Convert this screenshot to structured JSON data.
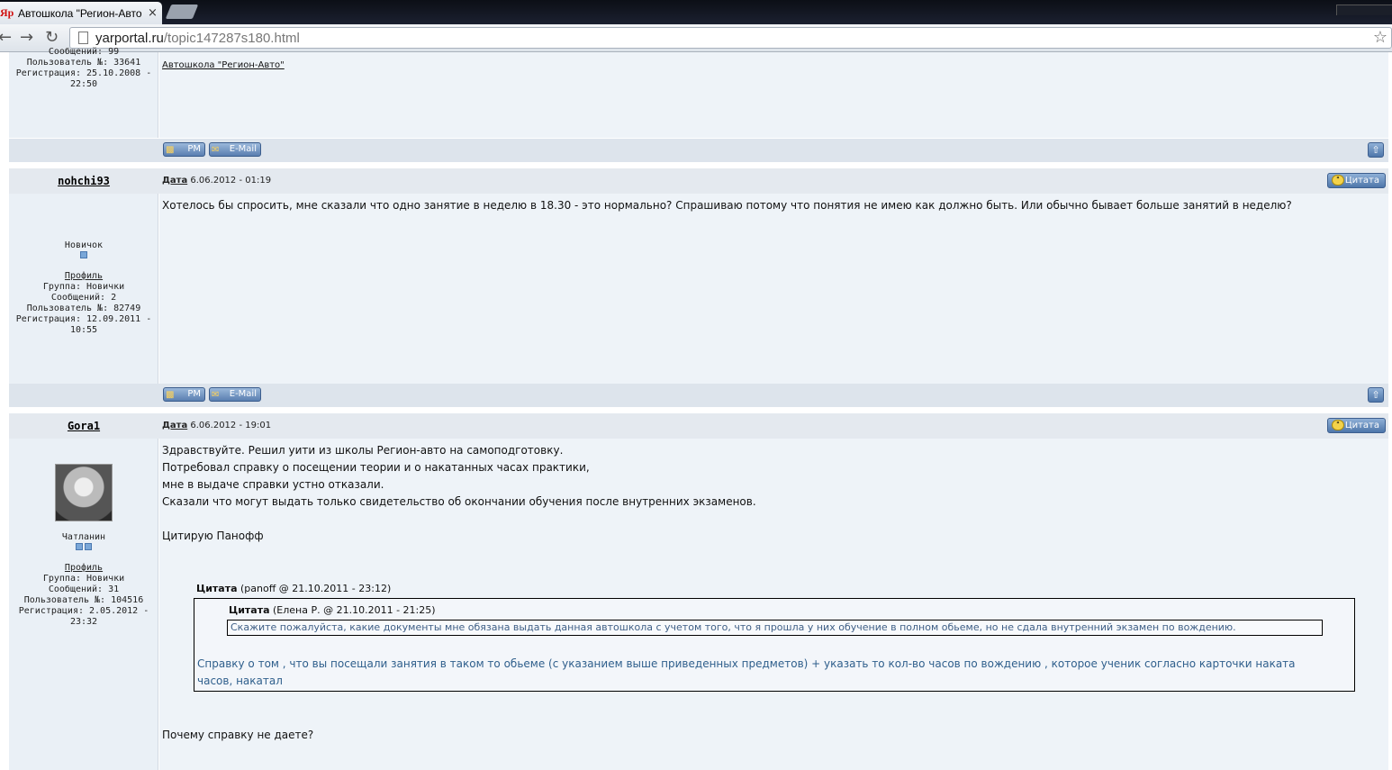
{
  "browser": {
    "tab_favicon": "Яр",
    "tab_title": "Автошкола \"Регион-Авто\"",
    "tab_close": "×",
    "url_host": "yarportal.ru",
    "url_path": "/topic147287s180.html",
    "icons": [
      "back-arrow-icon",
      "forward-arrow-icon",
      "reload-icon",
      "page-icon",
      "bookmark-star-icon"
    ]
  },
  "prev_post": {
    "meta_cut": "Сообщений: 99",
    "meta_user_no": "Пользователь №: 33641",
    "meta_reg": "Регистрация: 25.10.2008 -",
    "meta_reg_time": "22:50",
    "signature_link": "Автошкола \"Регион-Авто\""
  },
  "buttons": {
    "pm": "PM",
    "email": "E-Mail",
    "quote": "Цитата",
    "date_label": "Дата"
  },
  "posts": [
    {
      "author": "nohchi93",
      "date": "6.06.2012 - 01:19",
      "text": "Хотелось бы спросить, мне сказали что одно занятие в неделю в 18.30 - это нормально? Спрашиваю потому что понятия не имею как должно быть. Или обычно бывает больше занятий в неделю?",
      "rank": "Новичок",
      "profile": "Профиль",
      "group": "Группа: Новички",
      "messages": "Сообщений: 2",
      "user_no": "Пользователь №: 82749",
      "reg": "Регистрация: 12.09.2011 -",
      "reg_time": "10:55"
    },
    {
      "author": "Gora1",
      "date": "6.06.2012 - 19:01",
      "lines": [
        "Здравствуйте. Решил уити из школы Регион-авто на самоподготовку.",
        "Потребовал справку о посещении теории и о накатанных часах практики,",
        "мне в выдаче справки устно отказали.",
        "Сказали что могут выдать только свидетельство об окончании обучения после внутренних экзаменов.",
        "Цитирую Панофф"
      ],
      "rank": "Чатланин",
      "profile": "Профиль",
      "group": "Группа: Новички",
      "messages": "Сообщений: 31",
      "user_no": "Пользователь №: 104516",
      "reg": "Регистрация: 2.05.2012 -",
      "reg_time": "23:32",
      "quote_outer_title": "Цитата",
      "quote_outer_meta": "(panoff @ 21.10.2011 - 23:12)",
      "quote_inner_title": "Цитата",
      "quote_inner_meta": "(Елена Р. @ 21.10.2011 - 21:25)",
      "quote_inner_text": "Скажите пожалуйста, какие документы мне обязана выдать данная автошкола с учетом того, что  я прошла у них обучение в полном обьеме, но не сдала внутренний экзамен по вождению.",
      "quote_answer": "Справку о том , что вы посещали занятия в таком то обьеме (с указанием выше приведенных предметов) + указать то кол-во часов по вождению , которое ученик согласно карточки наката часов, накатал",
      "closing": "Почему справку не даете?"
    }
  ]
}
